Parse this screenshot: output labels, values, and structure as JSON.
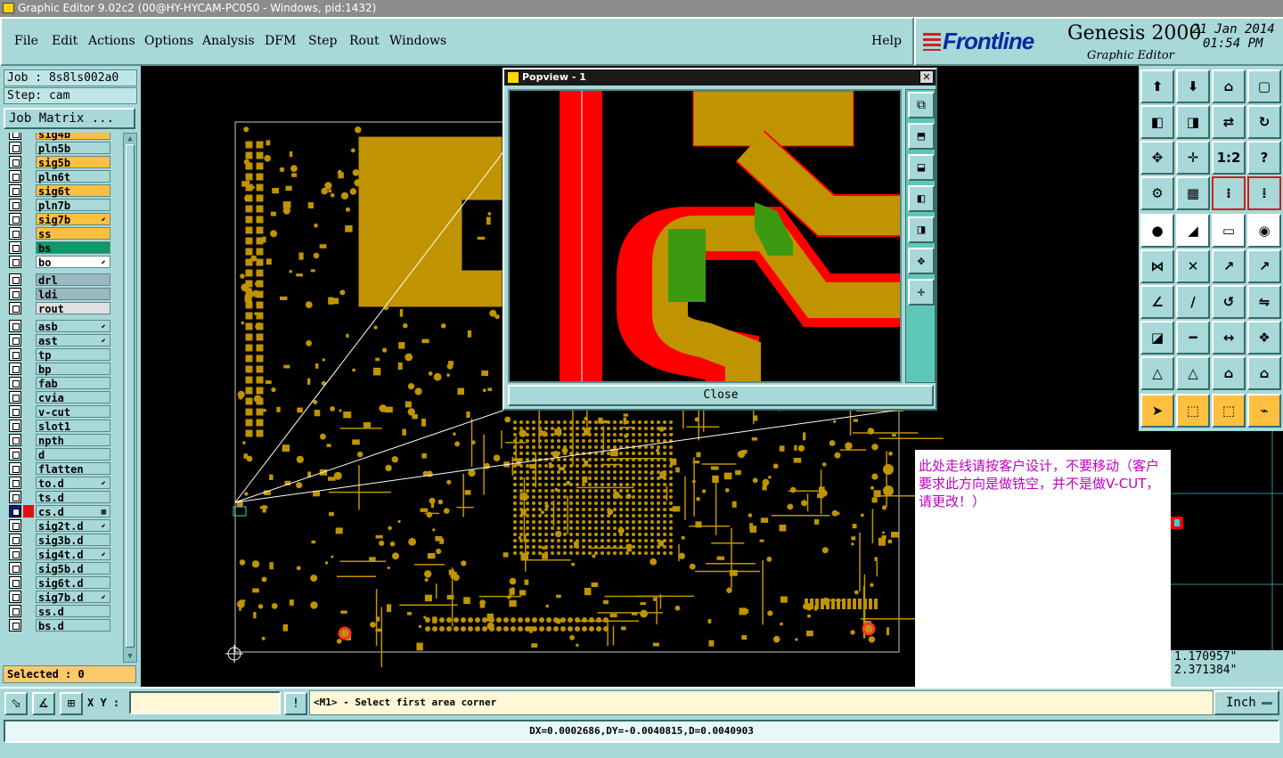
{
  "window": {
    "title": "Graphic Editor 9.02c2 (00@HY-HYCAM-PC050 - Windows, pid:1432)"
  },
  "menu": {
    "items": [
      "File",
      "Edit",
      "Actions",
      "Options",
      "Analysis",
      "DFM",
      "Step",
      "Rout",
      "Windows"
    ],
    "help": "Help"
  },
  "brand": {
    "logo": "Frontline",
    "product": "Genesis 2000",
    "subtitle": "Graphic Editor",
    "date": "21 Jan 2014",
    "time": "01:54 PM"
  },
  "job": {
    "job_line": "Job : 8s8ls002a0",
    "step_line": "Step: cam",
    "matrix_button": "Job Matrix ..."
  },
  "layers": [
    {
      "name": "sig4b",
      "color": "#ffc040",
      "flag": ""
    },
    {
      "name": "pln5b",
      "color": "#a8d8d8",
      "flag": ""
    },
    {
      "name": "sig5b",
      "color": "#ffc040",
      "flag": ""
    },
    {
      "name": "pln6t",
      "color": "#a8d8d8",
      "flag": ""
    },
    {
      "name": "sig6t",
      "color": "#ffc040",
      "flag": ""
    },
    {
      "name": "pln7b",
      "color": "#a8d8d8",
      "flag": ""
    },
    {
      "name": "sig7b",
      "color": "#ffc040",
      "flag": "⬋"
    },
    {
      "name": "ss",
      "color": "#ffc040",
      "flag": ""
    },
    {
      "name": "bs",
      "color": "#109868",
      "flag": ""
    },
    {
      "name": "bo",
      "color": "#ffffff",
      "flag": "⬋"
    },
    {
      "name": "drl",
      "color": "#9cb8c0",
      "flag": ""
    },
    {
      "name": "ldi",
      "color": "#9cb8c0",
      "flag": ""
    },
    {
      "name": "rout",
      "color": "#e0e0e0",
      "flag": ""
    },
    {
      "name": "asb",
      "color": "#a8d8d8",
      "flag": "⬋"
    },
    {
      "name": "ast",
      "color": "#a8d8d8",
      "flag": "⬋"
    },
    {
      "name": "tp",
      "color": "#a8d8d8",
      "flag": ""
    },
    {
      "name": "bp",
      "color": "#a8d8d8",
      "flag": ""
    },
    {
      "name": "fab",
      "color": "#a8d8d8",
      "flag": ""
    },
    {
      "name": "cvia",
      "color": "#a8d8d8",
      "flag": ""
    },
    {
      "name": "v-cut",
      "color": "#a8d8d8",
      "flag": ""
    },
    {
      "name": "slot1",
      "color": "#a8d8d8",
      "flag": ""
    },
    {
      "name": "npth",
      "color": "#a8d8d8",
      "flag": ""
    },
    {
      "name": "d",
      "color": "#a8d8d8",
      "flag": ""
    },
    {
      "name": "flatten",
      "color": "#a8d8d8",
      "flag": ""
    },
    {
      "name": "to.d",
      "color": "#a8d8d8",
      "flag": "⬋"
    },
    {
      "name": "ts.d",
      "color": "#a8d8d8",
      "flag": ""
    },
    {
      "name": "cs.d",
      "color": "#a8d8d8",
      "flag": "▦"
    },
    {
      "name": "sig2t.d",
      "color": "#a8d8d8",
      "flag": "⬋"
    },
    {
      "name": "sig3b.d",
      "color": "#a8d8d8",
      "flag": ""
    },
    {
      "name": "sig4t.d",
      "color": "#a8d8d8",
      "flag": "⬋"
    },
    {
      "name": "sig5b.d",
      "color": "#a8d8d8",
      "flag": ""
    },
    {
      "name": "sig6t.d",
      "color": "#a8d8d8",
      "flag": ""
    },
    {
      "name": "sig7b.d",
      "color": "#a8d8d8",
      "flag": "⬋"
    },
    {
      "name": "ss.d",
      "color": "#a8d8d8",
      "flag": ""
    },
    {
      "name": "bs.d",
      "color": "#a8d8d8",
      "flag": ""
    }
  ],
  "selected": "Selected : 0",
  "popview": {
    "title": "Popview - 1",
    "close_x": "✕",
    "close_button": "Close"
  },
  "note": "此处走线请按客户设计，不要移动（客户要求此方向是做铣空，并不是做V-CUT，请更改！）",
  "coords": {
    "x": "1.170957\"",
    "y": "2.371384\""
  },
  "command": {
    "xy_label": "X Y :",
    "xy_value": "",
    "prompt": "<M1> - Select first area corner",
    "units": "Inch"
  },
  "status": "DX=0.0002686,DY=-0.0040815,D=0.0040903",
  "colors": {
    "copper": "#c09400",
    "highlight": "#ff0000",
    "selected_green": "#3c9a10",
    "panel": "#a8d8d8"
  }
}
